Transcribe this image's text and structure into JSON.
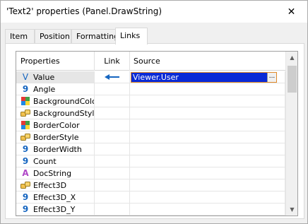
{
  "window": {
    "title": "'Text2' properties (Panel.DrawString)",
    "close_glyph": "✕"
  },
  "tabs": [
    {
      "label": "Item",
      "active": false
    },
    {
      "label": "Position",
      "active": false
    },
    {
      "label": "Formatting",
      "active": false
    },
    {
      "label": "Links",
      "active": true
    }
  ],
  "grid": {
    "headers": {
      "properties": "Properties",
      "link": "Link",
      "source": "Source"
    },
    "rows": [
      {
        "name": "Value",
        "icon": "variant-v-icon",
        "selected": true,
        "source": "Viewer.User",
        "link": "arrow-left"
      },
      {
        "name": "Angle",
        "icon": "number-icon"
      },
      {
        "name": "BackgroundColor",
        "icon": "color-icon"
      },
      {
        "name": "BackgroundStyle",
        "icon": "style-chain-icon"
      },
      {
        "name": "BorderColor",
        "icon": "color-icon"
      },
      {
        "name": "BorderStyle",
        "icon": "style-chain-icon"
      },
      {
        "name": "BorderWidth",
        "icon": "number-icon"
      },
      {
        "name": "Count",
        "icon": "number-icon"
      },
      {
        "name": "DocString",
        "icon": "text-a-icon"
      },
      {
        "name": "Effect3D",
        "icon": "style-chain-icon"
      },
      {
        "name": "Effect3D_X",
        "icon": "number-icon"
      },
      {
        "name": "Effect3D_Y",
        "icon": "number-icon"
      }
    ],
    "editor_button_label": "..."
  },
  "colors": {
    "accent": "#1565c0",
    "selection": "#0a2ad6",
    "editor_border": "#e08a2a"
  }
}
